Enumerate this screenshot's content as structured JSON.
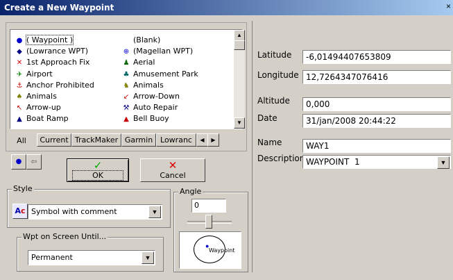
{
  "window": {
    "title": "Create a New Waypoint",
    "close_label": "×"
  },
  "symbols": {
    "items": [
      {
        "label": "( Waypoint )",
        "icon": "waypoint-dot-icon",
        "glyph": "●",
        "color": "#0000cc",
        "selected": true
      },
      {
        "label": "(Blank)",
        "icon": "blank-icon",
        "glyph": "",
        "color": "#000000"
      },
      {
        "label": "(Lowrance WPT)",
        "icon": "diamond-arrow-icon",
        "glyph": "◆",
        "color": "#000080"
      },
      {
        "label": "(Magellan WPT)",
        "icon": "globe-icon",
        "glyph": "⊕",
        "color": "#0000cc"
      },
      {
        "label": "1st Approach Fix",
        "icon": "x-mark-icon",
        "glyph": "✕",
        "color": "#cc0000"
      },
      {
        "label": "Aerial",
        "icon": "aerial-person-icon",
        "glyph": "♟",
        "color": "#006600"
      },
      {
        "label": "Airport",
        "icon": "airplane-icon",
        "glyph": "✈",
        "color": "#008000"
      },
      {
        "label": "Amusement Park",
        "icon": "amusement-park-icon",
        "glyph": "♣",
        "color": "#006666"
      },
      {
        "label": "Anchor Prohibited",
        "icon": "anchor-prohibited-icon",
        "glyph": "⚓",
        "color": "#cc0000"
      },
      {
        "label": "Animals",
        "icon": "animal-icon",
        "glyph": "♞",
        "color": "#808000"
      },
      {
        "label": "Animals",
        "icon": "animal-track-icon",
        "glyph": "♠",
        "color": "#808000"
      },
      {
        "label": "Arrow-Down",
        "icon": "arrow-down-icon",
        "glyph": "↙",
        "color": "#cc0000"
      },
      {
        "label": "Arrow-up",
        "icon": "arrow-up-icon",
        "glyph": "↖",
        "color": "#cc0000"
      },
      {
        "label": "Auto Repair",
        "icon": "auto-repair-icon",
        "glyph": "⚒",
        "color": "#000080"
      },
      {
        "label": "Boat Ramp",
        "icon": "boat-ramp-icon",
        "glyph": "▲",
        "color": "#000080"
      },
      {
        "label": "Bell Buoy",
        "icon": "bell-buoy-icon",
        "glyph": "▲",
        "color": "#cc0000"
      }
    ]
  },
  "tabs": [
    "All",
    "Current",
    "TrackMaker",
    "Garmin",
    "Lowranc"
  ],
  "buttons": {
    "ok": "OK",
    "cancel": "Cancel"
  },
  "style": {
    "label": "Style",
    "value": "Symbol with comment"
  },
  "wpt_on_screen": {
    "label": "Wpt on Screen Until...",
    "value": "Permanent"
  },
  "angle": {
    "label": "Angle",
    "value": "0",
    "preview_text": "Waypoint"
  },
  "fields": {
    "latitude": {
      "label": "Latitude",
      "value": "-6,01494407653809"
    },
    "longitude": {
      "label": "Longitude",
      "value": "12,7264347076416"
    },
    "altitude": {
      "label": "Altitude",
      "value": "0,000"
    },
    "date": {
      "label": "Date",
      "value": "31/jan/2008 20:44:22"
    },
    "name": {
      "label": "Name",
      "value": "WAY1"
    },
    "description": {
      "label": "Description",
      "value": "WAYPOINT  1"
    }
  }
}
